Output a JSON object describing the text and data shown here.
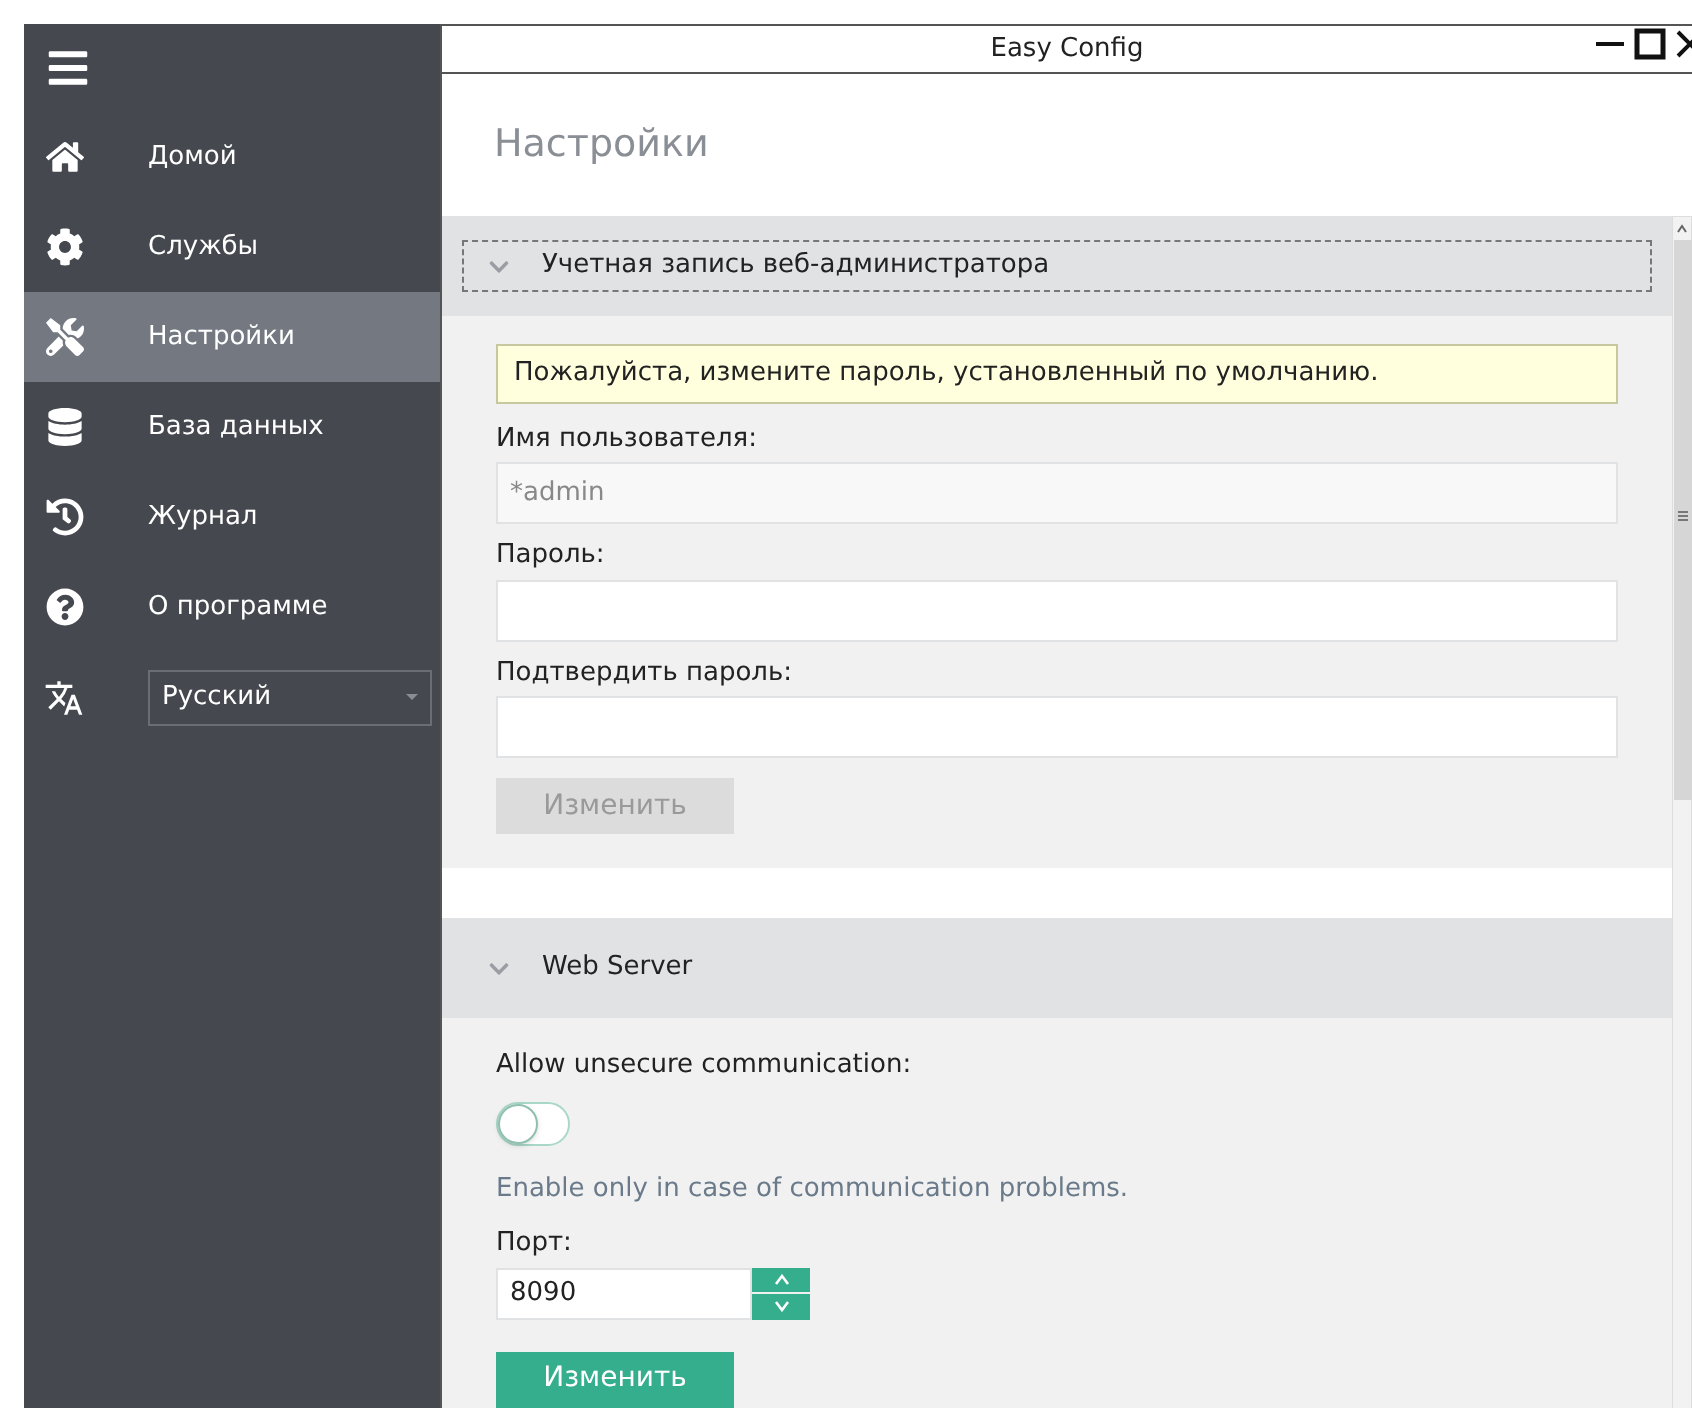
{
  "window": {
    "title": "Easy Config"
  },
  "sidebar": {
    "items": [
      {
        "kind": "home",
        "label": "Домой",
        "selected": false
      },
      {
        "kind": "services",
        "label": "Службы",
        "selected": false
      },
      {
        "kind": "settings",
        "label": "Настройки",
        "selected": true
      },
      {
        "kind": "database",
        "label": "База данных",
        "selected": false
      },
      {
        "kind": "log",
        "label": "Журнал",
        "selected": false
      },
      {
        "kind": "about",
        "label": "О программе",
        "selected": false
      }
    ],
    "language": {
      "value": "Русский"
    }
  },
  "page": {
    "title": "Настройки"
  },
  "sections": [
    {
      "title": "Учетная запись веб-администратора",
      "expanded": true,
      "focused": true,
      "fields": [
        {
          "kind": "notice",
          "text": "Пожалуйста, измените пароль, установленный по умолчанию."
        },
        {
          "kind": "text",
          "label": "Имя пользователя:",
          "value": "*admin",
          "disabled": true
        },
        {
          "kind": "text",
          "label": "Пароль:",
          "disabled": false
        },
        {
          "kind": "text",
          "label": "Подтвердить пароль:",
          "disabled": false
        },
        {
          "kind": "button",
          "label": "Изменить",
          "disabled": true
        }
      ]
    },
    {
      "title": "Web Server",
      "expanded": true,
      "focused": false,
      "fields": [
        {
          "kind": "switch",
          "label": "Allow unsecure communication:",
          "on": false
        },
        {
          "kind": "hint",
          "text": "Enable only in case of communication problems."
        },
        {
          "kind": "number",
          "label": "Порт:",
          "value": "8090"
        },
        {
          "kind": "button",
          "label": "Изменить",
          "disabled": false
        }
      ]
    }
  ]
}
